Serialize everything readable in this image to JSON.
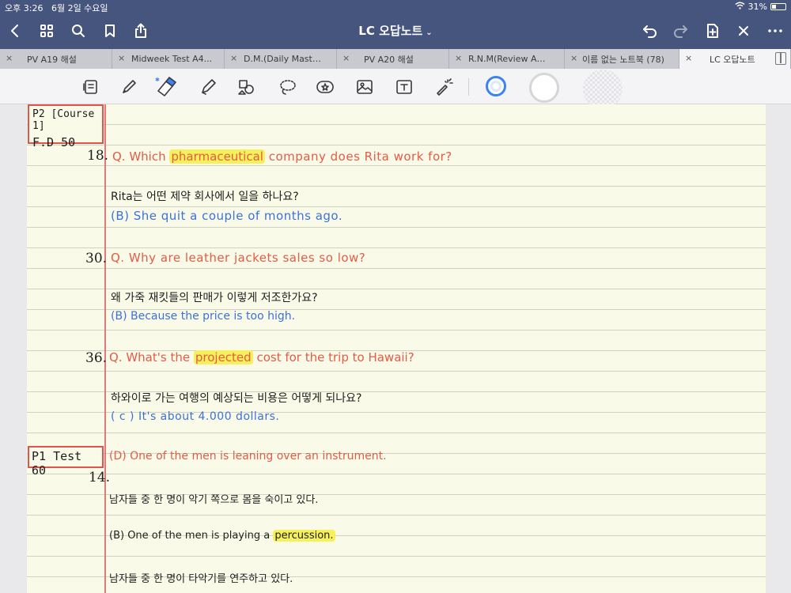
{
  "status_bar": {
    "time": "오후 3:26",
    "date": "6월 2일 수요일",
    "battery": "31%"
  },
  "nav": {
    "title": "LC 오답노트",
    "chevron": "⌄",
    "buttons": [
      "back",
      "thumbnails",
      "search",
      "bookmark",
      "share",
      "undo",
      "redo",
      "add-page",
      "close",
      "more"
    ]
  },
  "tabs": [
    {
      "label": "PV A19 해설",
      "close": "×"
    },
    {
      "label": "Midweek Test A4...",
      "close": "×"
    },
    {
      "label": "D.M.(Daily Master...",
      "close": "×"
    },
    {
      "label": "PV A20 해설",
      "close": "×"
    },
    {
      "label": "R.N.M(Review And...",
      "close": "×"
    },
    {
      "label": "이름 없는 노트북 (78)",
      "close": "×"
    },
    {
      "label": "LC 오답노트",
      "close": "×",
      "active": true
    }
  ],
  "toolbar": {
    "tools": [
      "page-view-icon",
      "pen-icon",
      "eraser-icon",
      "highlighter-icon",
      "shapes-icon",
      "lasso-icon",
      "sticker-icon",
      "image-icon",
      "text-icon",
      "laser-pointer-icon"
    ],
    "colors": {
      "selected": "#3b82f6",
      "secondary": "#d6d6d8",
      "tertiary": "#e4e4e8"
    }
  },
  "colors": {
    "question": "#e45b46",
    "answer": "#3c71d9",
    "highlight": "#f6f05a",
    "box": "#e3534a",
    "margin": "#e07a7a"
  },
  "note": {
    "label_p2": "P2 [Course 1]",
    "label_fd": "F.D 50",
    "label_p1": "P1 Test 60",
    "entries": {
      "q18_num": "18.",
      "q18_pre": "Q. Which",
      "q18_hl": "pharmaceutical",
      "q18_post": "company does Rita work for?",
      "q18_ko": "Rita는 어떤 제약 회사에서 일을 하나요?",
      "q18_ans": "(B) She quit a couple of months ago.",
      "q30_num": "30.",
      "q30_q": "Q. Why are leather jackets sales so low?",
      "q30_ko": "왜 가죽 재킷들의 판매가 이렇게 저조한가요?",
      "q30_ans": "(B) Because the price is too high.",
      "q36_num": "36.",
      "q36_pre": "Q. What's the",
      "q36_hl": "projected",
      "q36_post": "cost for the trip to Hawaii?",
      "q36_ko": "하와이로 가는 여행의 예상되는 비용은 어떻게 되나요?",
      "q36_ans": "( c ) It's about 4.000 dollars.",
      "p1_ans": "(D) One of the men is leaning over an instrument.",
      "q14_num": "14.",
      "q14_ko": "남자들 중 한 명이 악기 쪽으로 몸을 숙이고 있다.",
      "q14_b_pre": "(B) One of the men is playing a",
      "q14_b_hl": "percussion.",
      "q14_b_ko": "남자들 중 한 명이 타악기를 연주하고 있다."
    }
  }
}
